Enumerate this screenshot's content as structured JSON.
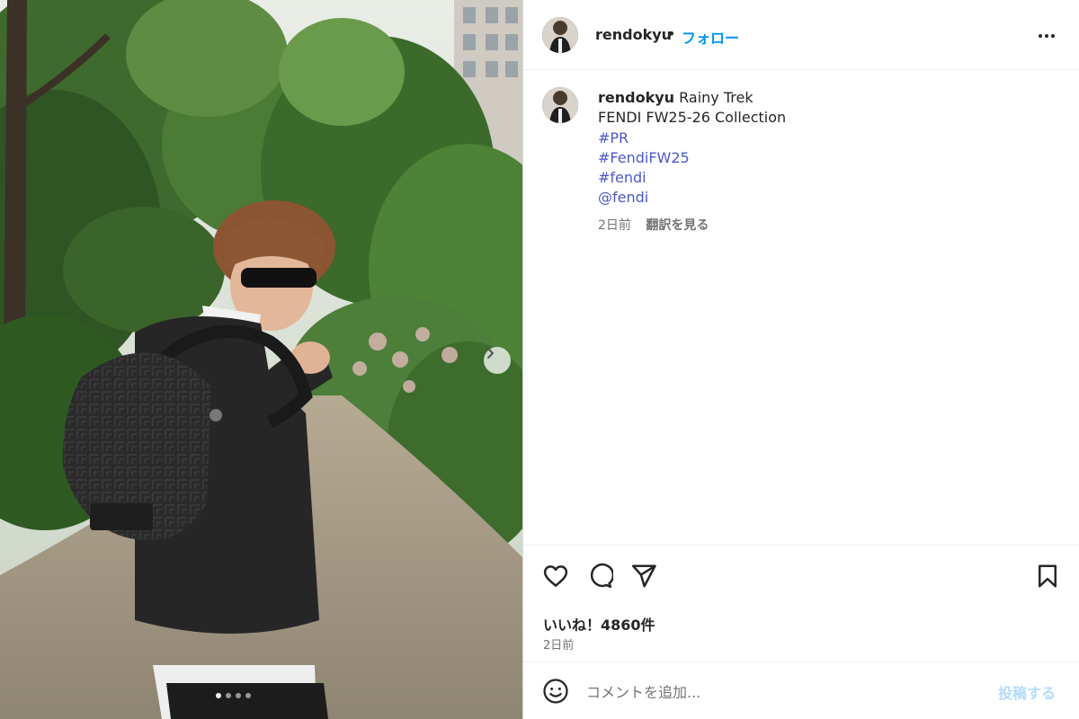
{
  "post": {
    "username": "rendokyu",
    "separator": "•",
    "follow_label": "フォロー",
    "caption": {
      "username": "rendokyu",
      "text_line1": "Rainy Trek",
      "text_line2": "FENDI FW25-26 Collection",
      "tags": [
        "#PR",
        "#FendiFW25",
        "#fendi",
        "@fendi"
      ]
    },
    "time_ago": "2日前",
    "translate_label": "翻訳を見る",
    "likes": "いいね！4860件",
    "date": "2日前"
  },
  "comment": {
    "placeholder": "コメントを追加...",
    "post_label": "投稿する"
  },
  "carousel": {
    "slide_count": 4,
    "active_index": 0
  },
  "icons": {
    "more": "more-options-icon",
    "like": "heart-icon",
    "comment": "comment-icon",
    "share": "send-icon",
    "save": "bookmark-icon",
    "emoji": "emoji-icon",
    "next": "chevron-right-icon"
  },
  "colors": {
    "link_blue": "#0095f6",
    "hashtag": "#4a58c8",
    "text": "#262626",
    "muted": "#737373",
    "post_disabled": "#b3dbff"
  }
}
